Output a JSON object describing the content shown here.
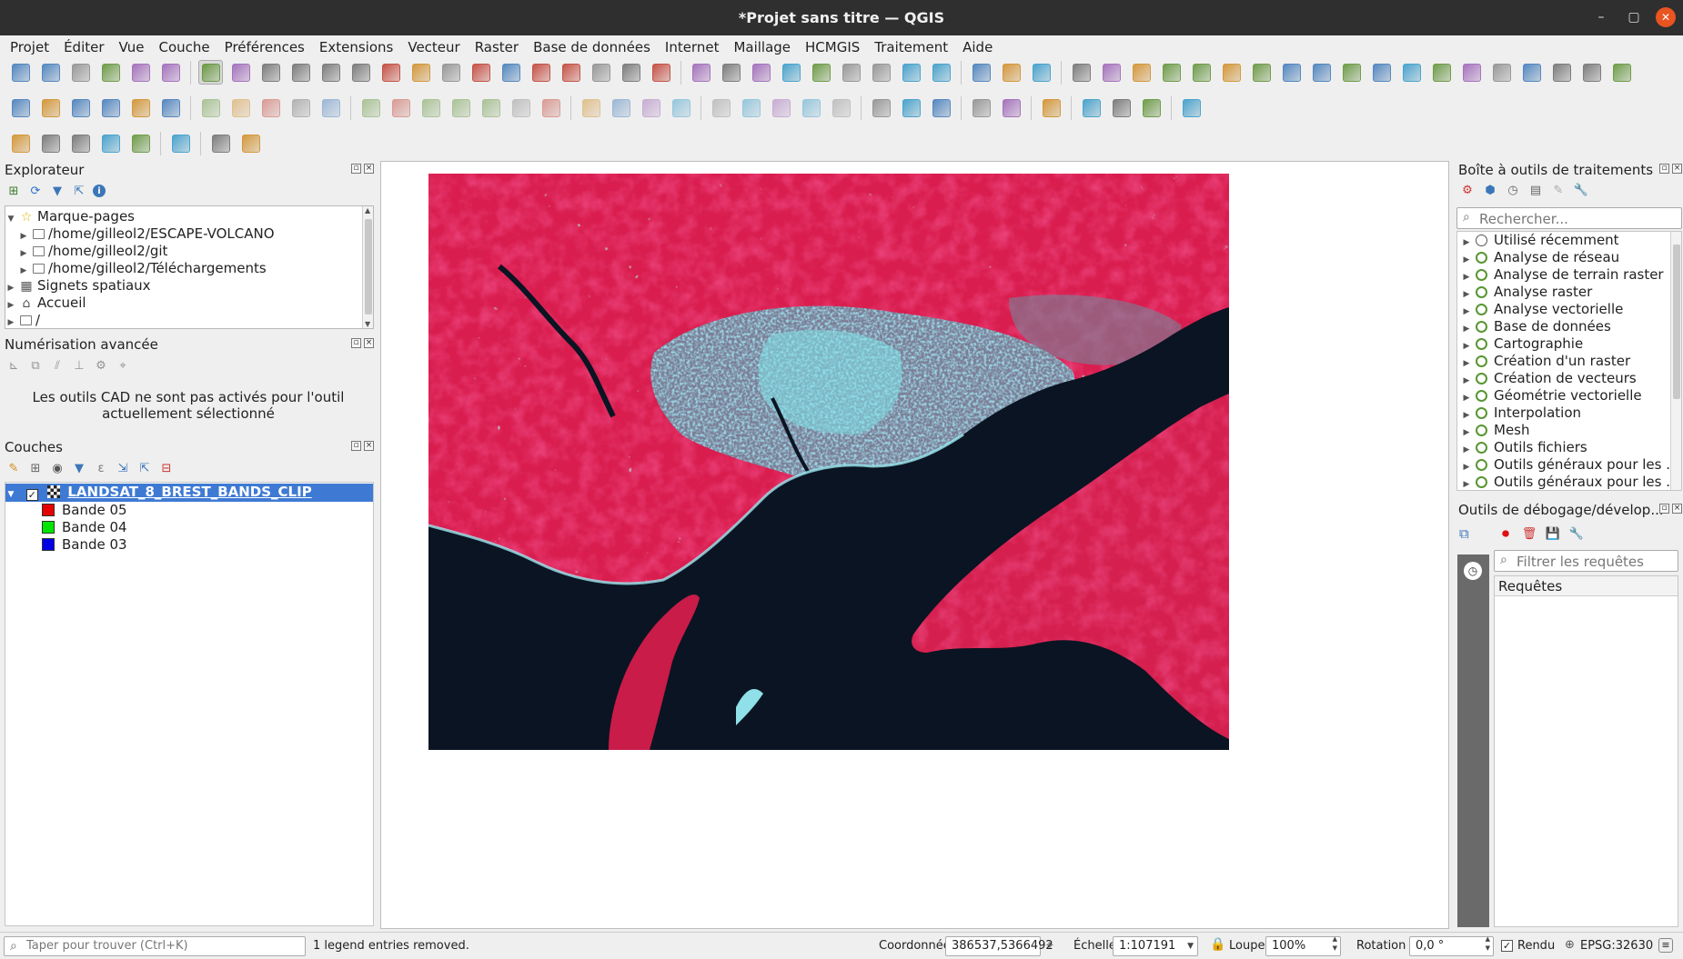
{
  "window": {
    "title": "*Projet sans titre — QGIS",
    "minimize_glyph": "–",
    "maximize_glyph": "▢",
    "close_glyph": "✕"
  },
  "menu": [
    "Projet",
    "Éditer",
    "Vue",
    "Couche",
    "Préférences",
    "Extensions",
    "Vecteur",
    "Raster",
    "Base de données",
    "Internet",
    "Maillage",
    "HCMGIS",
    "Traitement",
    "Aide"
  ],
  "toolbars": {
    "row1_icons": [
      "new-project-icon",
      "open-project-icon",
      "save-project-icon",
      "save-as-icon",
      "print-layout-icon",
      "style-manager-icon",
      "sep",
      "pan-icon",
      "pan-to-selection-icon",
      "zoom-in-icon",
      "zoom-out-icon",
      "zoom-full-icon",
      "zoom-layer-icon",
      "zoom-selection-icon",
      "zoom-native-icon",
      "zoom-last-icon",
      "zoom-next-icon",
      "new-map-view-icon",
      "new-3d-view-icon",
      "bookmark-new-icon",
      "show-bookmarks-icon",
      "temporal-controller-icon",
      "refresh-icon",
      "sep",
      "identify-icon",
      "attribute-table-icon",
      "processing-icon",
      "statistics-icon",
      "field-calculator-icon",
      "measure-icon",
      "map-tips-icon",
      "select-feature-icon",
      "text-annotation-icon",
      "sep",
      "digitize-line-icon",
      "digitize-polygon-icon",
      "vertex-tool-icon",
      "sep",
      "offset-curve-icon",
      "reshape-icon",
      "split-icon",
      "merge-icon",
      "rotate-icon",
      "simplify-icon",
      "add-ring-icon",
      "add-part-icon",
      "fill-ring-icon",
      "delete-ring-icon",
      "delete-part-icon",
      "reshape-features-icon",
      "offset-icon",
      "split-parts-icon",
      "split-features-icon",
      "merge-attributes-icon",
      "rotate-point-icon",
      "scale-icon",
      "undo-icon"
    ],
    "row2_icons": [
      "data-source-manager-icon",
      "new-geopackage-icon",
      "new-shapefile-icon",
      "new-temp-layer-icon",
      "new-virtual-layer-icon",
      "new-mesh-icon",
      "sep",
      "toggle-edit-icon",
      "current-edits-icon",
      "save-edits-icon",
      "digitize-icon",
      "vertex-icon",
      "sep",
      "modify-attributes-icon",
      "delete-selected-icon",
      "cut-icon",
      "copy-icon",
      "paste-icon",
      "undo-icon",
      "redo-icon",
      "sep",
      "label-tool-icon",
      "label-pin-icon",
      "label-highlight-icon",
      "label-show-hide-icon",
      "sep",
      "diagram-move-icon",
      "label-move-icon",
      "label-rotate-icon",
      "label-change-icon",
      "label-properties-icon",
      "sep",
      "metasearch-icon",
      "geocoder-icon",
      "earth-icon",
      "sep",
      "python-icon",
      "globe-icon",
      "sep",
      "help-icon",
      "sep",
      "select-rectangle-icon",
      "deselect-icon",
      "select-location-icon",
      "sep",
      "select-value-icon"
    ],
    "row3_icons": [
      "digitize-line-icon",
      "digitize-circle-icon",
      "digitize-ellipse-icon",
      "digitize-rectangle-icon",
      "digitize-polygon-icon",
      "sep",
      "ruler-icon",
      "sep",
      "locate-icon",
      "hcmgis-icon"
    ]
  },
  "explorer": {
    "title": "Explorateur",
    "items": [
      {
        "label": "Marque-pages",
        "level": 0,
        "expanded": true,
        "icon": "star-icon"
      },
      {
        "label": "/home/gilleol2/ESCAPE-VOLCANO",
        "level": 1,
        "icon": "folder-icon"
      },
      {
        "label": "/home/gilleol2/git",
        "level": 1,
        "icon": "folder-icon"
      },
      {
        "label": "/home/gilleol2/Téléchargements",
        "level": 1,
        "icon": "folder-icon"
      },
      {
        "label": "Signets spatiaux",
        "level": 0,
        "icon": "spatial-bookmark-icon"
      },
      {
        "label": "Accueil",
        "level": 0,
        "icon": "home-icon"
      },
      {
        "label": "/",
        "level": 0,
        "icon": "folder-icon"
      }
    ]
  },
  "advanced_digitizing": {
    "title": "Numérisation avancée",
    "message": "Les outils CAD ne sont pas activés pour l'outil actuellement sélectionné"
  },
  "layers": {
    "title": "Couches",
    "layer_name": "LANDSAT_8_BREST_BANDS_CLIP",
    "checked": true,
    "bands": [
      {
        "label": "Bande 05",
        "color": "#e60000"
      },
      {
        "label": "Bande 04",
        "color": "#00e600"
      },
      {
        "label": "Bande 03",
        "color": "#0000e6"
      }
    ]
  },
  "processing_toolbox": {
    "title": "Boîte à outils de traitements",
    "search_placeholder": "Rechercher...",
    "items": [
      "Utilisé récemment",
      "Analyse de réseau",
      "Analyse de terrain raster",
      "Analyse raster",
      "Analyse vectorielle",
      "Base de données",
      "Cartographie",
      "Création d'un raster",
      "Création de vecteurs",
      "Géométrie vectorielle",
      "Interpolation",
      "Mesh",
      "Outils fichiers",
      "Outils généraux pour les ...",
      "Outils généraux pour les ..."
    ]
  },
  "debug_panel": {
    "title": "Outils de débogage/dévelop...",
    "filter_placeholder": "Filtrer les requêtes",
    "requests_header": "Requêtes"
  },
  "statusbar": {
    "locator_placeholder": "Taper pour trouver (Ctrl+K)",
    "message": "1 legend entries removed.",
    "coord_label": "Coordonnée",
    "coord_value": "386537,5366492",
    "scale_label": "Échelle",
    "scale_value": "1:107191",
    "magnifier_label": "Loupe",
    "magnifier_value": "100%",
    "rotation_label": "Rotation",
    "rotation_value": "0,0 °",
    "render_label": "Rendu",
    "render_checked": true,
    "crs": "EPSG:32630"
  },
  "colors": {
    "layer_selected": "#3e7ad3",
    "vegetation": "#e8285a",
    "water": "#0b1220",
    "urban": "#7fdde6"
  }
}
